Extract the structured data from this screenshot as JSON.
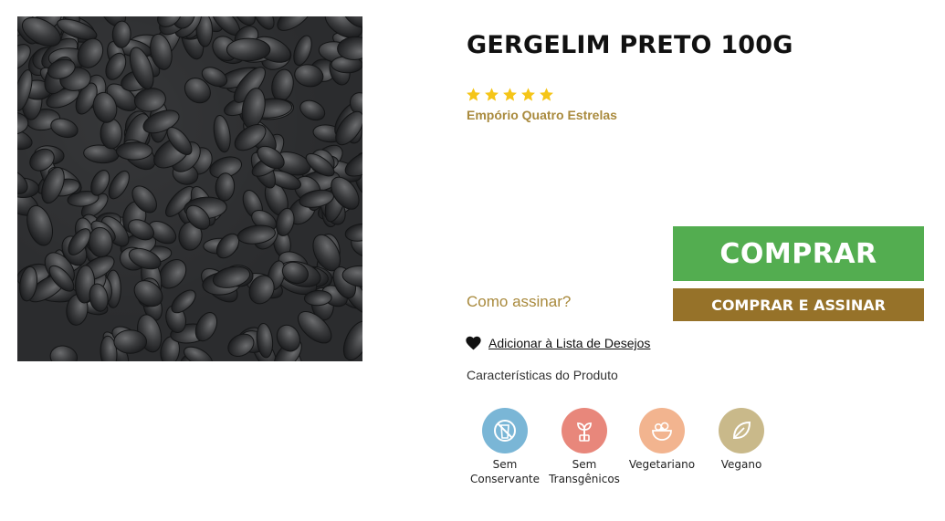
{
  "product": {
    "title": "GERGELIM PRETO 100G",
    "rating_stars": 5,
    "brand": "Empório Quatro Estrelas",
    "image_icon": "black-sesame-seeds-photo"
  },
  "actions": {
    "buy_label": "COMPRAR",
    "subscribe_label": "COMPRAR E ASSINAR",
    "how_to_subscribe": "Como assinar?",
    "wishlist_label": "Adicionar à Lista de Desejos"
  },
  "features": {
    "title": "Características do Produto",
    "items": [
      {
        "line1": "Sem",
        "line2": "Conservante",
        "icon": "no-preservatives-icon",
        "color": "#7ab6d6"
      },
      {
        "line1": "Sem",
        "line2": "Transgênicos",
        "icon": "sprout-icon",
        "color": "#e8877b"
      },
      {
        "line1": "Vegetariano",
        "line2": "",
        "icon": "salad-bowl-icon",
        "color": "#f2b48f"
      },
      {
        "line1": "Vegano",
        "line2": "",
        "icon": "leaf-icon",
        "color": "#c9b98a"
      }
    ]
  },
  "colors": {
    "buy_green": "#53ad50",
    "subscribe_brown": "#967229",
    "brand_gold": "#a98a3d",
    "star_yellow": "#f5c518"
  }
}
